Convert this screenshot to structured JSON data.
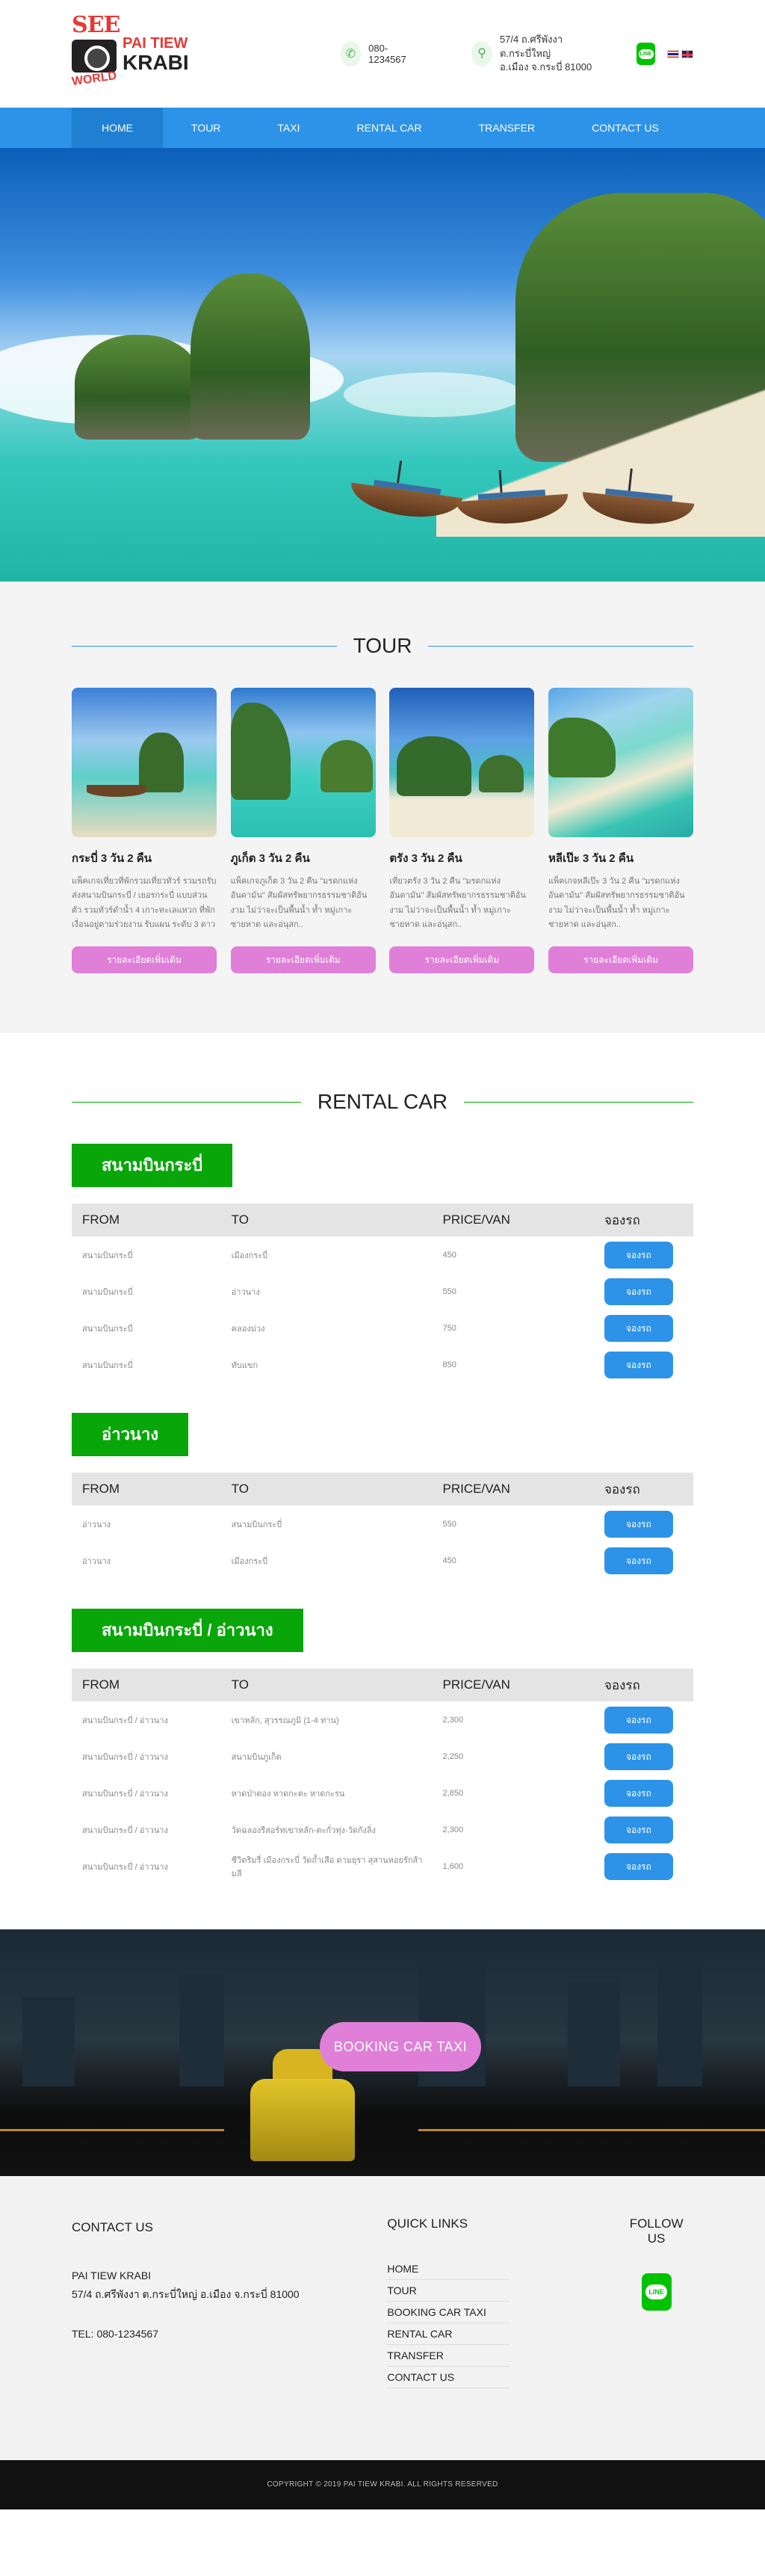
{
  "header": {
    "logo_see": "SEE",
    "logo_world": "WORLD",
    "logo_line1": "PAI TIEW",
    "logo_line2": "KRABI",
    "phone": "080-1234567",
    "address_line1": "57/4 ถ.ศรีพังงา ต.กระบี่ใหญ่",
    "address_line2": "อ.เมือง จ.กระบี่ 81000",
    "line_label": "LINE"
  },
  "nav": {
    "items": [
      "HOME",
      "TOUR",
      "TAXI",
      "RENTAL CAR",
      "TRANSFER",
      "CONTACT US"
    ],
    "active": "HOME"
  },
  "tour": {
    "title": "TOUR",
    "cards": [
      {
        "name": "กระบี่ 3 วัน 2 คืน",
        "desc": "แพ็คเกจเที่ยวที่พักรวมเที่ยวทัวร์ รวมรถรับส่งสนามบินกระบี่ / เยอรกระบี่ แบบส่วนตัว รวมทัวร์ดำน้ำ 4 เกาะทะเลแหวก ที่พักเงื่อนอยู่ตามร่วยงาน รับแผน ระดับ 3 ดาวหรือ..",
        "button": "รายละเอียดเพิ่มเติม"
      },
      {
        "name": "ภูเก็ต 3 วัน 2 คืน",
        "desc": "แพ็คเกจภูเก็ต 3 วัน 2 คืน \"มรดกแห่งอันดามัน\" สัมผัสทรัพยากรธรรมชาติอันงาม ไม่ว่าจะเป็นพื้นน้ำ ท้ำ หมู่เกาะ ชายหาด และอ่นุสก..",
        "button": "รายละเอียดเพิ่มเติม"
      },
      {
        "name": "ตรัง 3 วัน 2 คืน",
        "desc": "เที่ยวตรัง 3 วัน 2 คืน \"มรดกแห่งอันดามัน\" สัมผัสทรัพยากรธรรมชาติอันงาม ไม่ว่าจะเป็นพื้นน้ำ ท้ำ หมู่เกาะ ชายหาด และอ่นุสก..",
        "button": "รายละเอียดเพิ่มเติม"
      },
      {
        "name": "หลีเป๊ะ 3 วัน 2 คืน",
        "desc": "แพ็คเกจหลีเป๊ะ 3 วัน 2 คืน \"มรดกแห่งอันดามัน\" สัมผัสทรัพยากรธรรมชาติอันงาม ไม่ว่าจะเป็นพื้นน้ำ ท้ำ หมู่เกาะ ชายหาด และอ่นุสก..",
        "button": "รายละเอียดเพิ่มเติม"
      }
    ]
  },
  "rental": {
    "title": "RENTAL CAR",
    "columns": [
      "FROM",
      "TO",
      "PRICE/VAN",
      "จองรถ"
    ],
    "book_label": "จองรถ",
    "zones": [
      {
        "name": "สนามบินกระบี่",
        "rows": [
          [
            "สนามบินกระบี่",
            "เมืองกระบี่",
            "450"
          ],
          [
            "สนามบินกระบี่",
            "อ่าวนาง",
            "550"
          ],
          [
            "สนามบินกระบี่",
            "คลองม่วง",
            "750"
          ],
          [
            "สนามบินกระบี่",
            "ทับแขก",
            "850"
          ]
        ]
      },
      {
        "name": "อ่าวนาง",
        "rows": [
          [
            "อ่าวนาง",
            "สนามบินกระบี่",
            "550"
          ],
          [
            "อ่าวนาง",
            "เมืองกระบี่",
            "450"
          ]
        ]
      },
      {
        "name": "สนามบินกระบี่ / อ่าวนาง",
        "rows": [
          [
            "สนามบินกระบี่ / อ่าวนาง",
            "เขาหลัก, สุวรรณภูมิ (1-4 ท่าน)",
            "2,300"
          ],
          [
            "สนามบินกระบี่ / อ่าวนาง",
            "สนามบินภูเก็ต",
            "2,250"
          ],
          [
            "สนามบินกระบี่ / อ่าวนาง",
            "หาดป่าตอง หาดกะตะ หาดกะรน",
            "2,850"
          ],
          [
            "สนามบินกระบี่ / อ่าวนาง",
            "วัดฉลองรีสอร์ทเขาหลัก-ตะกั่วทุ่ง-วัดกังลิ่ง",
            "2,300"
          ],
          [
            "สนามบินกระบี่ / อ่าวนาง",
            "ชีวิตริมรี่ เมืองกระบี่ วัดถ้ำเสือ ตามยุรา สุสานหอยรักส้ามลี",
            "1,600"
          ]
        ]
      }
    ]
  },
  "banner": {
    "button": "BOOKING CAR TAXI"
  },
  "footer": {
    "contact_title": "CONTACT US",
    "company": "PAI TIEW KRABI",
    "address": "57/4 ถ.ศรีพังงา ต.กระบี่ใหญ่ อ.เมือง จ.กระบี่ 81000",
    "tel": "TEL: 080-1234567",
    "links_title": "QUICK LINKS",
    "links": [
      "HOME",
      "TOUR",
      "BOOKING CAR TAXI",
      "RENTAL CAR",
      "TRANSFER",
      "CONTACT US"
    ],
    "follow_title": "FOLLOW US",
    "line_label": "LINE",
    "copyright": "COPYRIGHT © 2019 PAI TIEW KRABI. ALL RIGHTS RESERVED"
  },
  "colors": {
    "nav_blue": "#2d93e9",
    "green": "#09a609",
    "pink": "#e07fd8",
    "red": "#e53935"
  }
}
